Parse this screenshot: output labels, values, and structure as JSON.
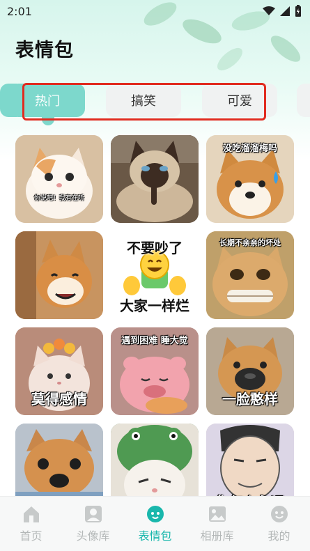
{
  "status_bar": {
    "time": "2:01"
  },
  "header": {
    "title": "表情包"
  },
  "tabs": [
    {
      "label": "热门",
      "active": true
    },
    {
      "label": "搞笑",
      "active": false
    },
    {
      "label": "可爱",
      "active": false
    }
  ],
  "stickers": [
    {
      "caption_top": "",
      "caption_bottom": "你说吧！我有在听",
      "bg": "#d9c2a6",
      "animal": "cat-white-orange"
    },
    {
      "caption_top": "",
      "caption_bottom": "",
      "bg": "#6b5a48",
      "animal": "cat-siamese"
    },
    {
      "caption_top": "没吃溜溜梅吗",
      "caption_bottom": "",
      "bg": "#e8d9c2",
      "animal": "shiba"
    },
    {
      "caption_top": "",
      "caption_bottom": "",
      "bg": "#c98e55",
      "animal": "shiba-smile"
    },
    {
      "caption_top": "不要吵了",
      "caption_bottom": "大家一样烂",
      "bg": "#ffffff",
      "animal": "emoji"
    },
    {
      "caption_top": "长期不亲亲的坏处",
      "caption_bottom": "",
      "bg": "#c9a15f",
      "animal": "cat-grin"
    },
    {
      "caption_top": "",
      "caption_bottom": "莫得感情",
      "bg": "#c99b86",
      "animal": "cat-flower"
    },
    {
      "caption_top": "遇到困难  睡大觉",
      "caption_bottom": "",
      "bg": "#c99694",
      "animal": "plush-pink"
    },
    {
      "caption_top": "",
      "caption_bottom": "一脸憨样",
      "bg": "#b9a996",
      "animal": "shiba-sad"
    },
    {
      "caption_top": "",
      "caption_bottom": "",
      "bg": "#a9b7c4",
      "animal": "dog-blanket"
    },
    {
      "caption_top": "",
      "caption_bottom": "",
      "bg": "#4f8a57",
      "animal": "cat-frog-hat"
    },
    {
      "caption_top": "",
      "caption_bottom": "你怎么永远",
      "bg": "#d8cdc4",
      "animal": "man-cartoon"
    }
  ],
  "bottom_nav": [
    {
      "label": "首页",
      "icon": "home-icon",
      "active": false
    },
    {
      "label": "头像库",
      "icon": "avatar-icon",
      "active": false
    },
    {
      "label": "表情包",
      "icon": "sticker-icon",
      "active": true
    },
    {
      "label": "相册库",
      "icon": "album-icon",
      "active": false
    },
    {
      "label": "我的",
      "icon": "profile-icon",
      "active": false
    }
  ],
  "colors": {
    "accent": "#19b7ac",
    "tab_active": "#7dd8cc",
    "highlight_box": "#e12b1f"
  }
}
